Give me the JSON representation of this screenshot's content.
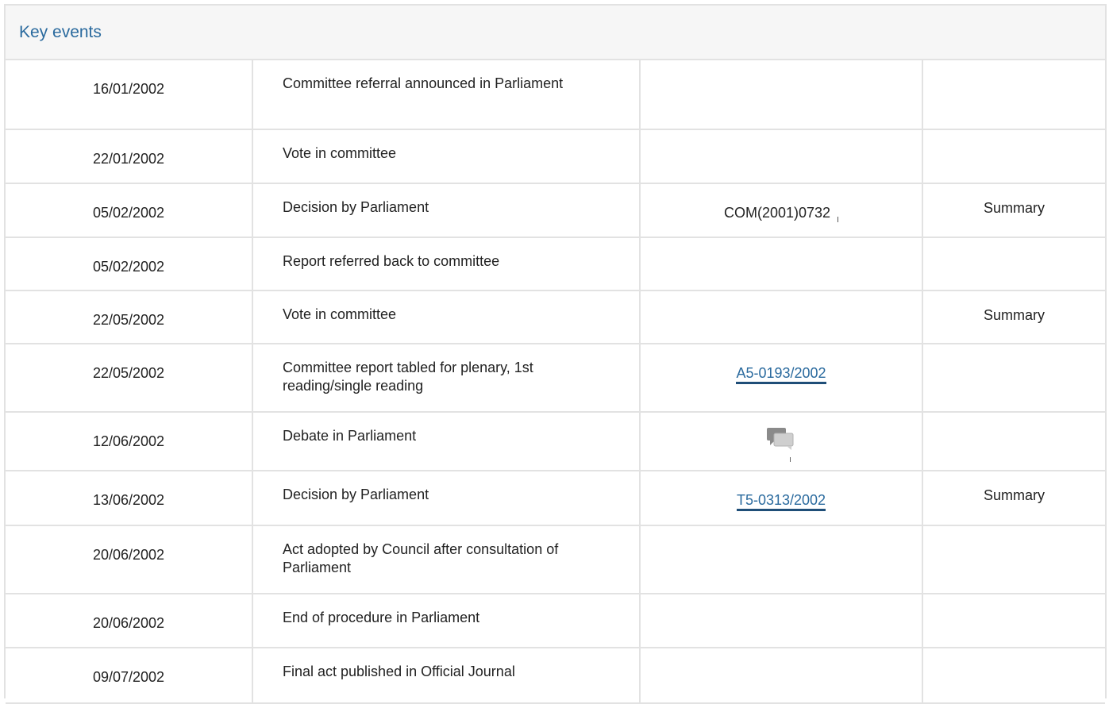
{
  "panel": {
    "title": "Key events"
  },
  "events": [
    {
      "date": "16/01/2002",
      "event": "Committee referral announced in Parliament",
      "document": "",
      "summary": ""
    },
    {
      "date": "22/01/2002",
      "event": "Vote in committee",
      "document": "",
      "summary": ""
    },
    {
      "date": "05/02/2002",
      "event": "Decision by Parliament",
      "document": "COM(2001)0732",
      "summary": "Summary"
    },
    {
      "date": "05/02/2002",
      "event": "Report referred back to committee",
      "document": "",
      "summary": ""
    },
    {
      "date": "22/05/2002",
      "event": "Vote in committee",
      "document": "",
      "summary": "Summary"
    },
    {
      "date": "22/05/2002",
      "event": "Committee report tabled for plenary, 1st reading/single reading",
      "document": "A5-0193/2002",
      "summary": ""
    },
    {
      "date": "12/06/2002",
      "event": "Debate in Parliament",
      "document": "",
      "summary": ""
    },
    {
      "date": "13/06/2002",
      "event": "Decision by Parliament",
      "document": "T5-0313/2002",
      "summary": "Summary"
    },
    {
      "date": "20/06/2002",
      "event": "Act adopted by Council after consultation of Parliament",
      "document": "",
      "summary": ""
    },
    {
      "date": "20/06/2002",
      "event": "End of procedure in Parliament",
      "document": "",
      "summary": ""
    },
    {
      "date": "09/07/2002",
      "event": "Final act published in Official Journal",
      "document": "",
      "summary": ""
    }
  ],
  "icons": {
    "debate": "debate-speech-bubbles-icon"
  },
  "colors": {
    "link": "#2a6a9e",
    "header_bg": "#f6f6f6",
    "border": "#e2e2e2"
  }
}
